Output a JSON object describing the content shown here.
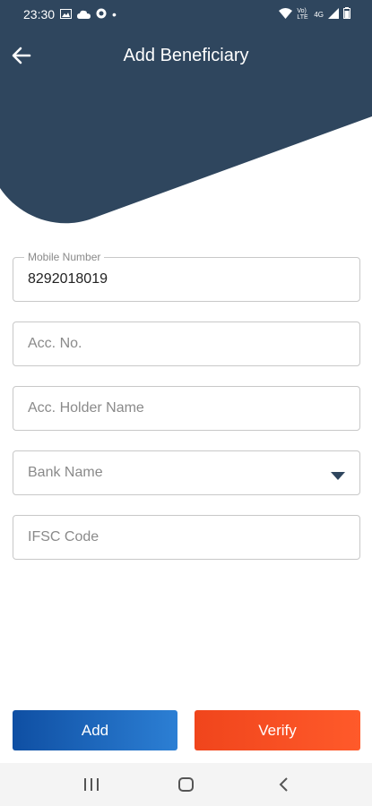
{
  "status_bar": {
    "time": "23:30",
    "dot": "•",
    "left_icons": [
      "image-icon",
      "cloud-icon",
      "vpn-icon"
    ],
    "right_icons": [
      "wifi-icon",
      "volte-icon",
      "4g-icon",
      "signal-icon",
      "battery-icon"
    ],
    "volte_text": "Vo) LTE",
    "net_text": "4G"
  },
  "header": {
    "title": "Add Beneficiary",
    "back_icon": "arrow-left-icon",
    "background_color": "#2f465e"
  },
  "form": {
    "mobile": {
      "label": "Mobile Number",
      "value": "8292018019"
    },
    "account_no": {
      "placeholder": "Acc. No."
    },
    "holder_name": {
      "placeholder": "Acc. Holder Name"
    },
    "bank_name": {
      "placeholder": "Bank Name",
      "icon": "dropdown-caret-icon"
    },
    "ifsc": {
      "placeholder": "IFSC Code"
    }
  },
  "actions": {
    "add_label": "Add",
    "verify_label": "Verify",
    "add_color": "#1a5fb8",
    "verify_color": "#f44d22"
  },
  "navbar": {
    "icons": [
      "recent-apps-icon",
      "home-icon",
      "back-icon"
    ]
  }
}
